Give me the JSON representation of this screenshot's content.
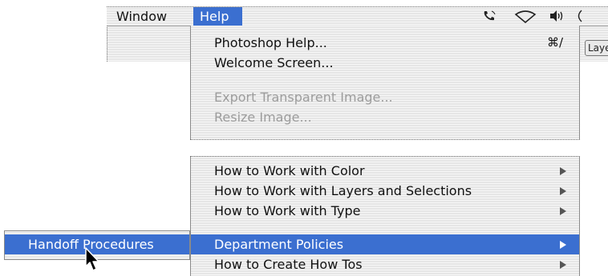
{
  "menubar": {
    "window_label": "Window",
    "help_label": "Help",
    "status_icons": [
      "phone-icon",
      "airport-icon",
      "volume-icon",
      "battery-icon"
    ]
  },
  "background_window": {
    "tab_label": "Laye"
  },
  "help_menu": {
    "items_top": [
      {
        "label": "Photoshop Help...",
        "shortcut": "⌘/",
        "enabled": true
      },
      {
        "label": "Welcome Screen...",
        "enabled": true
      },
      {
        "label": "Export Transparent Image...",
        "enabled": false
      },
      {
        "label": "Resize Image...",
        "enabled": false
      }
    ],
    "items_bottom": [
      {
        "label": "How to Work with Color",
        "submenu": true
      },
      {
        "label": "How to Work with Layers and Selections",
        "submenu": true
      },
      {
        "label": "How to Work with Type",
        "submenu": true
      },
      {
        "label": "Department Policies",
        "submenu": true,
        "selected": true
      },
      {
        "label": "How to Create How Tos",
        "submenu": true
      }
    ]
  },
  "submenu": {
    "items": [
      {
        "label": "Handoff Procedures",
        "selected": true
      }
    ]
  },
  "colors": {
    "selection": "#3b6fd0",
    "disabled_text": "#9c9c9c"
  }
}
